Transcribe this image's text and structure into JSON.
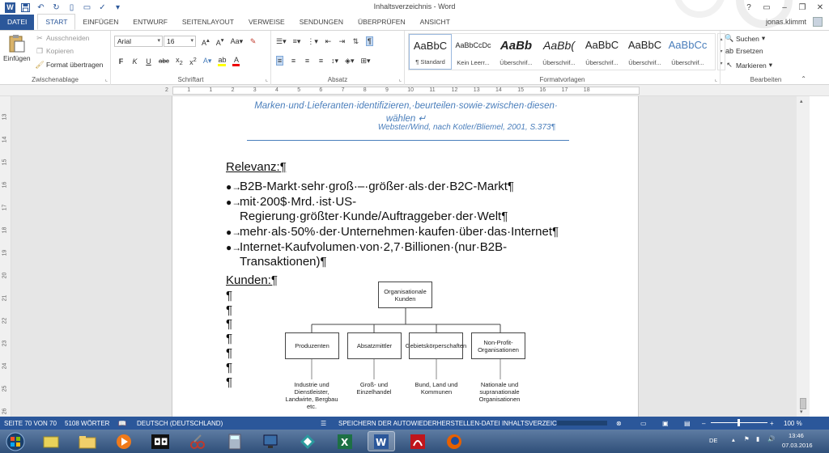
{
  "app": {
    "title": "Inhaltsverzeichnis - Word",
    "user": "jonas.klimmt",
    "help": "?"
  },
  "tabs": [
    "DATEI",
    "START",
    "EINFÜGEN",
    "ENTWURF",
    "SEITENLAYOUT",
    "VERWEISE",
    "SENDUNGEN",
    "ÜBERPRÜFEN",
    "ANSICHT"
  ],
  "ribbon": {
    "clipboard": {
      "paste": "Einfügen",
      "cut": "Ausschneiden",
      "copy": "Kopieren",
      "format_painter": "Format übertragen",
      "label": "Zwischenablage"
    },
    "font": {
      "name": "Arial",
      "size": "16",
      "label": "Schriftart"
    },
    "paragraph": {
      "label": "Absatz"
    },
    "styles": {
      "label": "Formatvorlagen",
      "items": [
        {
          "sample": "AaBbC",
          "name": "¶ Standard"
        },
        {
          "sample": "AaBbCcDc",
          "name": "Kein Leerr..."
        },
        {
          "sample": "AaBb",
          "name": "Überschrif..."
        },
        {
          "sample": "AaBb(",
          "name": "Überschrif..."
        },
        {
          "sample": "AaBbC",
          "name": "Überschrif..."
        },
        {
          "sample": "AaBbC",
          "name": "Überschrif..."
        },
        {
          "sample": "AaBbCc",
          "name": "Überschrif..."
        }
      ]
    },
    "editing": {
      "find": "Suchen",
      "replace": "Ersetzen",
      "select": "Markieren",
      "label": "Bearbeiten"
    }
  },
  "ruler": {
    "h_ticks": [
      "2",
      "1",
      "1",
      "2",
      "3",
      "4",
      "5",
      "6",
      "7",
      "8",
      "9",
      "10",
      "11",
      "12",
      "13",
      "14",
      "15",
      "16",
      "17",
      "18"
    ],
    "v_ticks": [
      "13",
      "14",
      "15",
      "16",
      "17",
      "18",
      "19",
      "20",
      "21",
      "22",
      "23",
      "24",
      "25",
      "26"
    ]
  },
  "document": {
    "quote_line1": "Marken·und·Lieferanten·identifizieren,·beurteilen·sowie·zwischen·diesen·",
    "quote_line2": "wählen ↵",
    "source": "Webster/Wind, nach Kotler/Bliemel, 2001, S.373¶",
    "relevanz_heading": "Relevanz:¶",
    "bullets": [
      "B2B-Markt·sehr·groß·–·größer·als·der·B2C-Markt¶",
      "mit·200$·Mrd.·ist·US-Regierung·größter·Kunde/Auftraggeber·der·Welt¶",
      "mehr·als·50%·der·Unternehmen·kaufen·über·das·Internet¶",
      "Internet-Kaufvolumen·von·2,7·Billionen·(nur·B2B-Transaktionen)¶"
    ],
    "kunden_heading": "Kunden:¶",
    "pilcrow": "¶"
  },
  "orgchart": {
    "root": "Organisationale Kunden",
    "children": [
      {
        "label": "Produzenten",
        "caption": "Industrie und Dienstleister, Landwirte, Bergbau etc."
      },
      {
        "label": "Absatzmittler",
        "caption": "Groß- und Einzelhandel"
      },
      {
        "label": "Gebietskörperschaften",
        "caption": "Bund, Land und Kommunen"
      },
      {
        "label": "Non-Profit-Organisationen",
        "caption": "Nationale und supranationale Organisationen"
      }
    ]
  },
  "status": {
    "page": "SEITE 70 VON 70",
    "words": "5108 WÖRTER",
    "language": "DEUTSCH (DEUTSCHLAND)",
    "saving": "SPEICHERN DER AUTOWIEDERHERSTELLEN-DATEI INHALTSVERZEICHNIS:",
    "zoom": "100 %"
  },
  "taskbar": {
    "lang": "DE",
    "time": "13:46",
    "date": "07.03.2016"
  }
}
